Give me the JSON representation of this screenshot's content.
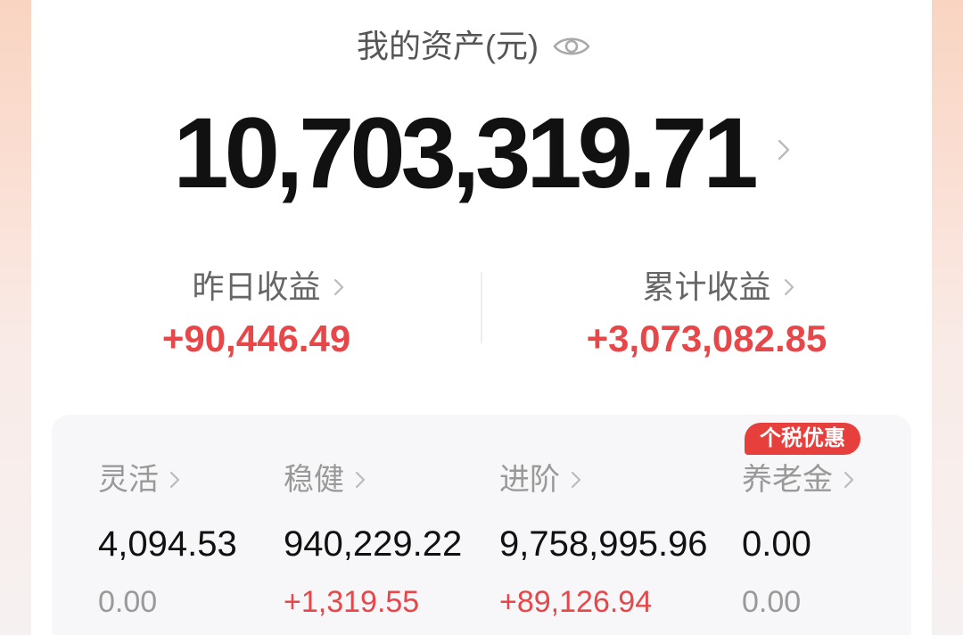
{
  "header": {
    "title": "我的资产(元)"
  },
  "icons": {
    "visibility": "eye-icon",
    "chevron": "chevron-right-icon"
  },
  "total_assets": {
    "value": "10,703,319.71"
  },
  "earnings": [
    {
      "label": "昨日收益",
      "value": "+90,446.49"
    },
    {
      "label": "累计收益",
      "value": "+3,073,082.85"
    }
  ],
  "categories": {
    "badge": "个税优惠",
    "items": [
      {
        "label": "灵活",
        "value": "4,094.53",
        "change": "0.00",
        "change_color": "#999999"
      },
      {
        "label": "稳健",
        "value": "940,229.22",
        "change": "+1,319.55",
        "change_color": "#e84749"
      },
      {
        "label": "进阶",
        "value": "9,758,995.96",
        "change": "+89,126.94",
        "change_color": "#e84749"
      },
      {
        "label": "养老金",
        "value": "0.00",
        "change": "0.00",
        "change_color": "#999999"
      }
    ]
  },
  "colors": {
    "gain": "#e84749",
    "badge": "#e63f3c",
    "text_primary": "#111111",
    "text_secondary": "#999999"
  }
}
